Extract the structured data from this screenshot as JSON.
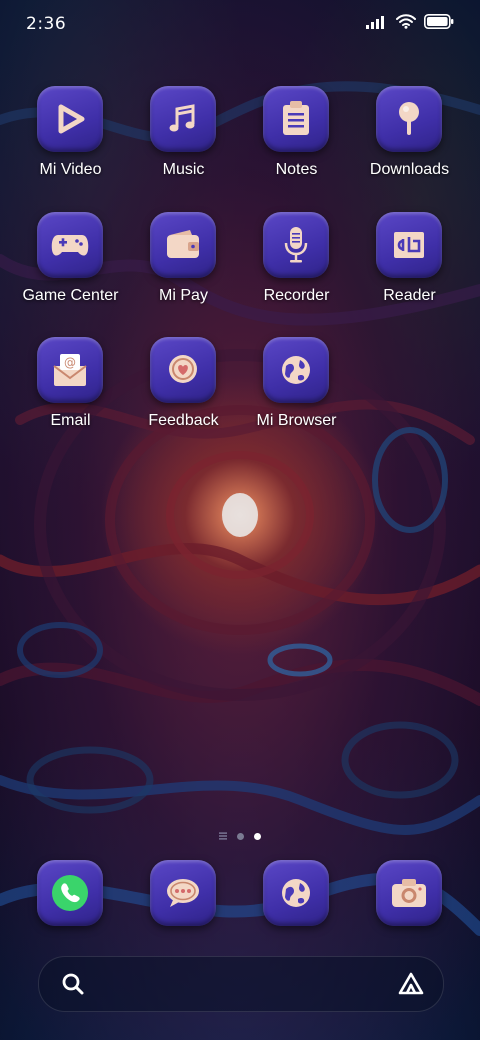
{
  "status_bar": {
    "time": "2:36"
  },
  "apps": [
    {
      "label": "Mi Video",
      "icon": "play-icon"
    },
    {
      "label": "Music",
      "icon": "music-note-icon"
    },
    {
      "label": "Notes",
      "icon": "notes-clipboard-icon"
    },
    {
      "label": "Downloads",
      "icon": "download-pin-icon"
    },
    {
      "label": "Game Center",
      "icon": "gamepad-icon"
    },
    {
      "label": "Mi Pay",
      "icon": "wallet-icon"
    },
    {
      "label": "Recorder",
      "icon": "microphone-icon"
    },
    {
      "label": "Reader",
      "icon": "reader-book-icon"
    },
    {
      "label": "Email",
      "icon": "email-at-icon"
    },
    {
      "label": "Feedback",
      "icon": "feedback-heart-icon"
    },
    {
      "label": "Mi Browser",
      "icon": "globe-icon"
    }
  ],
  "dock": [
    {
      "icon": "phone-icon"
    },
    {
      "icon": "messages-icon"
    },
    {
      "icon": "browser-globe-icon"
    },
    {
      "icon": "camera-icon"
    }
  ],
  "page_indicator": {
    "pages": 2,
    "current": 2
  },
  "colors": {
    "icon_bg": "#4a3ab8",
    "glyph": "#f3d7c6",
    "glyph_dark": "#c9876e",
    "phone_green": "#3ad46b"
  }
}
